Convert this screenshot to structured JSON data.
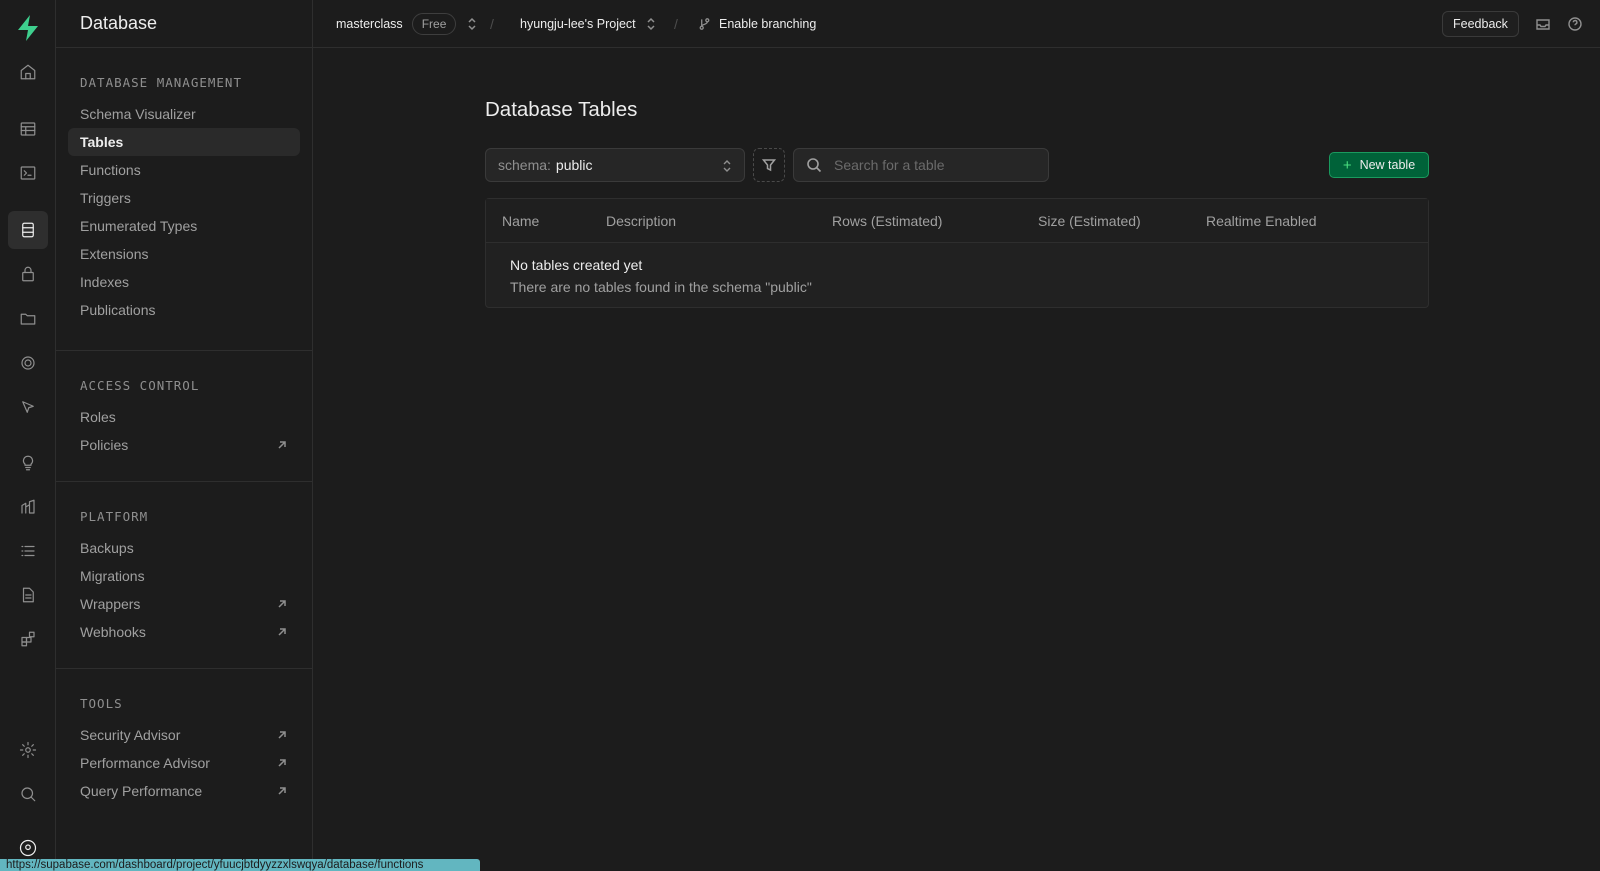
{
  "app": {
    "section_title": "Database"
  },
  "topbar": {
    "org": "masterclass",
    "plan_badge": "Free",
    "project": "hyungju-lee's Project",
    "branching": "Enable branching",
    "feedback": "Feedback"
  },
  "sidebar": {
    "sections": [
      {
        "heading": "DATABASE MANAGEMENT",
        "items": [
          {
            "label": "Schema Visualizer"
          },
          {
            "label": "Tables"
          },
          {
            "label": "Functions"
          },
          {
            "label": "Triggers"
          },
          {
            "label": "Enumerated Types"
          },
          {
            "label": "Extensions"
          },
          {
            "label": "Indexes"
          },
          {
            "label": "Publications"
          }
        ]
      },
      {
        "heading": "ACCESS CONTROL",
        "items": [
          {
            "label": "Roles"
          },
          {
            "label": "Policies"
          }
        ]
      },
      {
        "heading": "PLATFORM",
        "items": [
          {
            "label": "Backups"
          },
          {
            "label": "Migrations"
          },
          {
            "label": "Wrappers"
          },
          {
            "label": "Webhooks"
          }
        ]
      },
      {
        "heading": "TOOLS",
        "items": [
          {
            "label": "Security Advisor"
          },
          {
            "label": "Performance Advisor"
          },
          {
            "label": "Query Performance"
          }
        ]
      }
    ]
  },
  "main": {
    "title": "Database Tables",
    "schema_label": "schema:",
    "schema_value": "public",
    "search_placeholder": "Search for a table",
    "new_table": "New table",
    "columns": [
      "Name",
      "Description",
      "Rows (Estimated)",
      "Size (Estimated)",
      "Realtime Enabled"
    ],
    "empty_title": "No tables created yet",
    "empty_desc": "There are no tables found in the schema \"public\""
  },
  "status_url": "https://supabase.com/dashboard/project/yfuucjbtdyyzzxlswqya/database/functions",
  "colors": {
    "accent": "#3ecf8e",
    "button_bg": "#006239",
    "background": "#1c1c1c"
  }
}
